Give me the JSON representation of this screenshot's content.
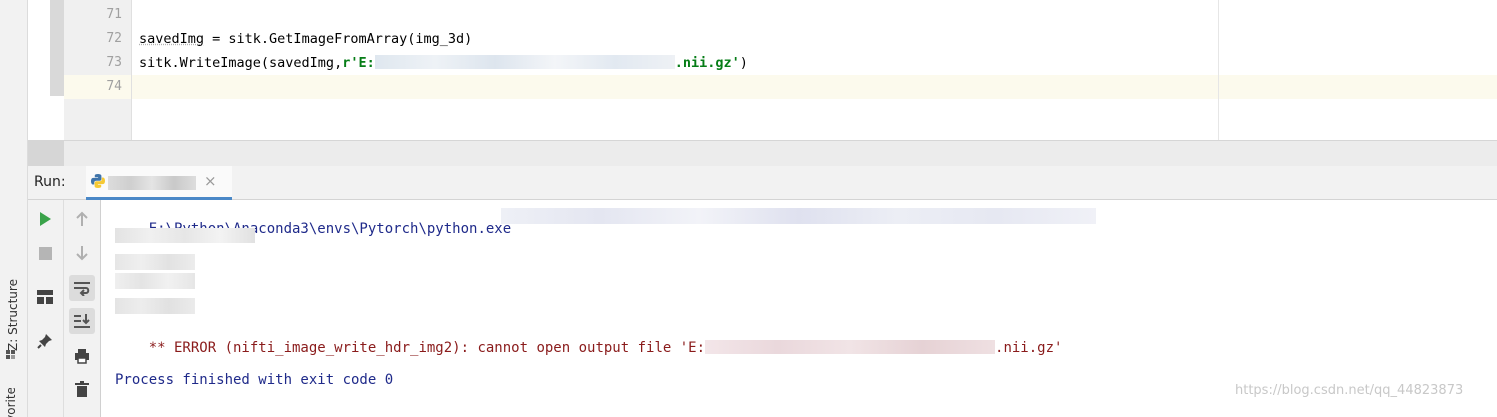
{
  "left_strip": {
    "structure_label": "Z: Structure",
    "favorites_label": "Favorites"
  },
  "editor": {
    "line_numbers": [
      "71",
      "72",
      "73",
      "74"
    ],
    "line72": {
      "var": "savedImg",
      "rest": " = sitk.GetImageFromArray(img_3d)"
    },
    "line73": {
      "prefix": "sitk.WriteImage(savedImg,",
      "string_start": "r'E:",
      "string_end": ".nii.gz'",
      "suffix": ")"
    }
  },
  "run_panel": {
    "label": "Run:",
    "tab_close": "×"
  },
  "console": {
    "cmd": "E:\\Python\\Anaconda3\\envs\\Pytorch\\python.exe",
    "error_prefix": "** ERROR (nifti_image_write_hdr_img2): cannot open output file 'E:",
    "error_suffix": ".nii.gz'",
    "exit": "Process finished with exit code 0"
  },
  "watermark": "https://blog.csdn.net/qq_44823873",
  "colors": {
    "run_green": "#3aa34a",
    "console_blue": "#1f2a8a",
    "error_red": "#8a1b1b",
    "string_green": "#067d17",
    "tab_underline": "#4a88c7"
  },
  "icons": {
    "run": "play-icon",
    "stop": "stop-icon",
    "layout": "layout-icon",
    "pin": "pin-icon",
    "up": "arrow-up-icon",
    "down": "arrow-down-icon",
    "wrap": "soft-wrap-icon",
    "scroll_end": "scroll-to-end-icon",
    "print": "print-icon",
    "clear": "trash-icon",
    "python": "python-icon"
  }
}
